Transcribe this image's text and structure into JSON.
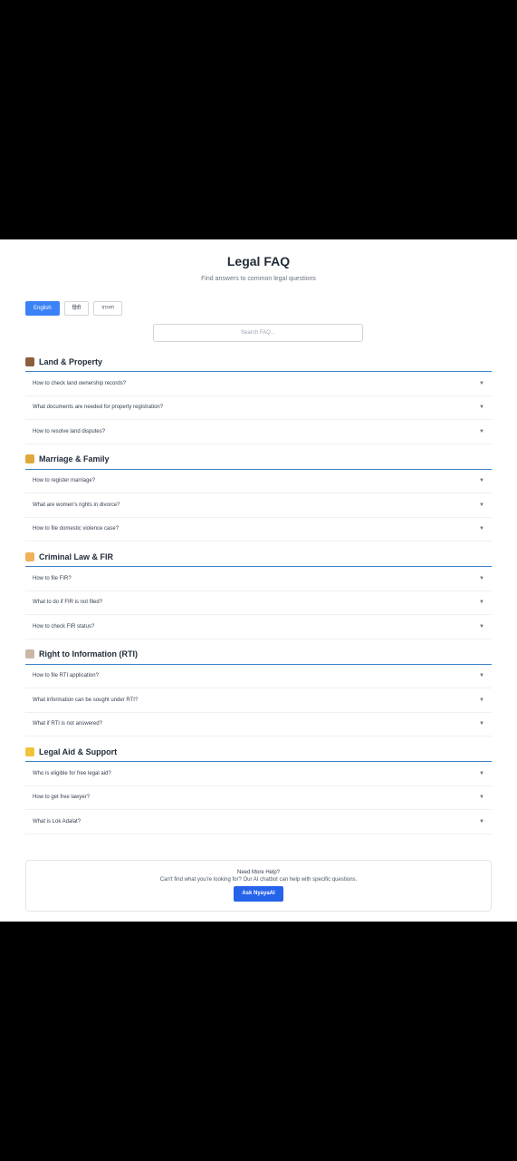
{
  "header": {
    "title": "Legal FAQ",
    "subtitle": "Find answers to common legal questions"
  },
  "languages": [
    {
      "label": "English",
      "active": true
    },
    {
      "label": "हिंदी",
      "active": false
    },
    {
      "label": "বাংলা",
      "active": false
    }
  ],
  "search": {
    "placeholder": "Search FAQ..."
  },
  "sections": [
    {
      "title": "Land & Property",
      "icon": "house-icon",
      "icon_color": "#8b5e3c",
      "questions": [
        "How to check land ownership records?",
        "What documents are needed for property registration?",
        "How to resolve land disputes?"
      ]
    },
    {
      "title": "Marriage & Family",
      "icon": "family-icon",
      "icon_color": "#e0a93b",
      "questions": [
        "How to register marriage?",
        "What are women's rights in divorce?",
        "How to file domestic violence case?"
      ]
    },
    {
      "title": "Criminal Law & FIR",
      "icon": "police-icon",
      "icon_color": "#f0b15a",
      "questions": [
        "How to file FIR?",
        "What to do if FIR is not filed?",
        "How to check FIR status?"
      ]
    },
    {
      "title": "Right to Information (RTI)",
      "icon": "document-icon",
      "icon_color": "#c9b8a3",
      "questions": [
        "How to file RTI application?",
        "What information can be sought under RTI?",
        "What if RTI is not answered?"
      ]
    },
    {
      "title": "Legal Aid & Support",
      "icon": "handshake-icon",
      "icon_color": "#f2c23a",
      "questions": [
        "Who is eligible for free legal aid?",
        "How to get free lawyer?",
        "What is Lok Adalat?"
      ]
    }
  ],
  "help": {
    "title": "Need More Help?",
    "text": "Can't find what you're looking for? Our AI chatbot can help with specific questions.",
    "button_label": "Ask NyayaAI"
  }
}
